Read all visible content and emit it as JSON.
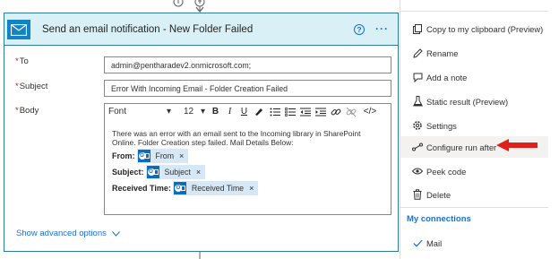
{
  "card": {
    "title": "Send an email notification - New Folder Failed",
    "help_glyph": "?",
    "more_glyph": "···",
    "accent_color": "#1483c3",
    "header_color": "#d9f0f7"
  },
  "fields": {
    "to": {
      "label": "To",
      "required_mark": "*",
      "value": "admin@pentharadev2.onmicrosoft.com;"
    },
    "subject": {
      "label": "Subject",
      "required_mark": "*",
      "value": "Error With Incoming Email - Folder Creation Failed"
    },
    "body": {
      "label": "Body",
      "required_mark": "*"
    }
  },
  "toolbar": {
    "font": "Font",
    "size": "12",
    "bold": "B",
    "italic": "I",
    "underline": "U",
    "code": "</>"
  },
  "body": {
    "text": "There was an error with an email sent to the Incoming library in SharePoint Online. Folder Creation step failed. Mail Details Below:",
    "tokens": [
      {
        "label": "From:",
        "token": "From",
        "remove": "×"
      },
      {
        "label": "Subject:",
        "token": "Subject",
        "remove": "×"
      },
      {
        "label": "Received Time:",
        "token": "Received Time",
        "remove": "×"
      }
    ]
  },
  "advanced": {
    "label": "Show advanced options"
  },
  "menu": {
    "items": [
      {
        "label": "Copy to my clipboard (Preview)",
        "icon": "copy-icon"
      },
      {
        "label": "Rename",
        "icon": "pencil-icon"
      },
      {
        "label": "Add a note",
        "icon": "note-icon"
      },
      {
        "label": "Static result (Preview)",
        "icon": "flask-icon"
      },
      {
        "label": "Settings",
        "icon": "gear-icon"
      },
      {
        "label": "Configure run after",
        "icon": "run-after-icon"
      },
      {
        "label": "Peek code",
        "icon": "eye-icon"
      },
      {
        "label": "Delete",
        "icon": "trash-icon"
      }
    ],
    "connections_heading": "My connections",
    "connection": {
      "label": "Mail",
      "icon": "check-icon"
    }
  },
  "colors": {
    "link": "#1a6fd6",
    "arrow": "#e0201b",
    "token_bg": "#d6e8f5"
  }
}
